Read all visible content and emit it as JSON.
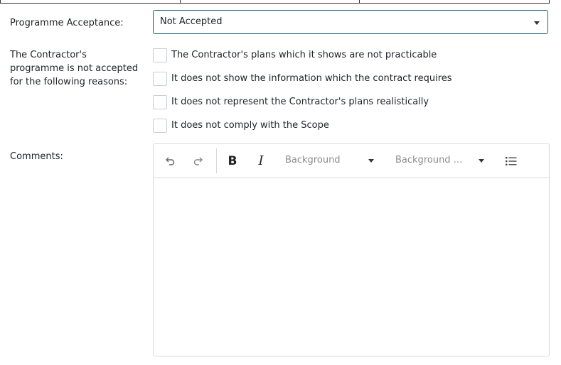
{
  "form": {
    "acceptance_label": "Programme Acceptance:",
    "acceptance_value": "Not Accepted",
    "reasons_label": "The Contractor's programme is not accepted for the following reasons:",
    "reasons": [
      {
        "text": "The Contractor's plans which it shows are not practicable",
        "checked": false
      },
      {
        "text": "It does not show the information which the contract requires",
        "checked": false
      },
      {
        "text": "It does not represent the Contractor's plans realistically",
        "checked": false
      },
      {
        "text": "It does not comply with the Scope",
        "checked": false
      }
    ],
    "comments_label": "Comments:"
  },
  "editor": {
    "toolbar": {
      "undo_icon": "undo-icon",
      "redo_icon": "redo-icon",
      "bold_label": "B",
      "italic_label": "I",
      "background_dropdown_1": "Background",
      "background_dropdown_2": "Background ...",
      "list_icon": "bulleted-list-icon"
    },
    "content": ""
  },
  "colors": {
    "select_border": "#1f5f7a",
    "border": "#d7dadd",
    "text": "#212529",
    "muted": "#8c8c8c"
  }
}
